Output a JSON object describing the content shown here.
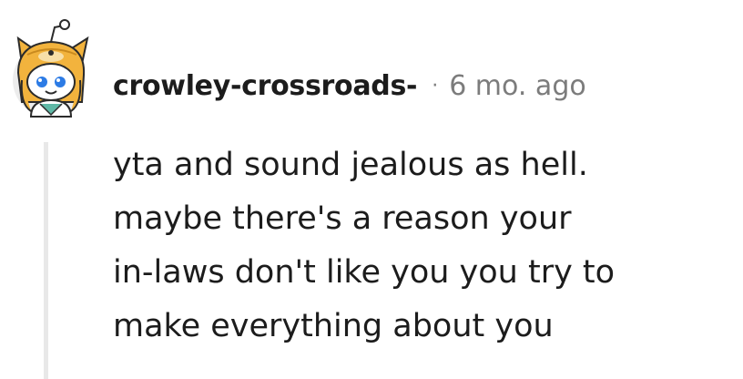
{
  "comment": {
    "author": "crowley-crossroads-",
    "separator": "·",
    "timestamp": "6 mo. ago",
    "body_lines": [
      "yta and sound jealous as hell.",
      "maybe there's a reason your",
      "in-laws don't like you you try to",
      "make everything about you"
    ],
    "avatar_icon": "snoo-doge-avatar-icon",
    "colors": {
      "username": "#1c1c1c",
      "meta": "#7c7c7c",
      "thread_line": "#e8e8e8",
      "avatar_hood": "#f2b33d"
    }
  }
}
